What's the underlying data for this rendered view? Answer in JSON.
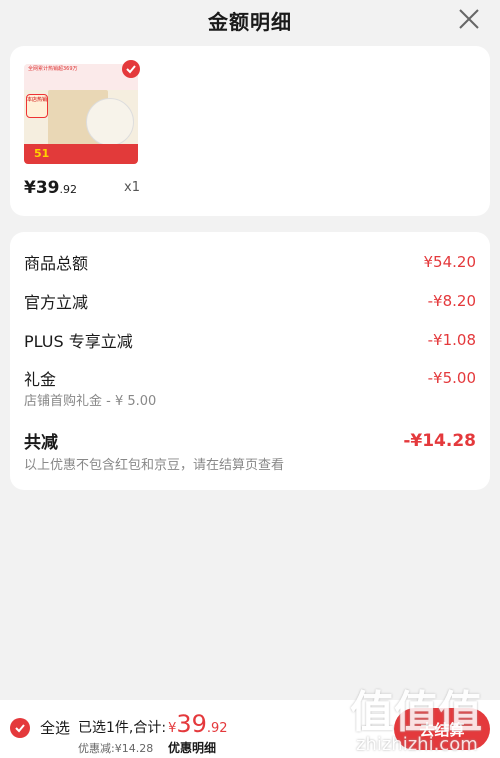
{
  "header": {
    "title": "金额明细"
  },
  "product": {
    "price_int": "¥39",
    "price_dec": ".92",
    "quantity": "x1",
    "thumb_banner": "全网累计热销超369万",
    "thumb_tag": "本店热销",
    "thumb_number": "51"
  },
  "details": {
    "rows": [
      {
        "label": "商品总额",
        "value": "¥54.20"
      },
      {
        "label": "官方立减",
        "value": "-¥8.20"
      },
      {
        "label": "PLUS 专享立减",
        "value": "-¥1.08"
      },
      {
        "label": "礼金",
        "value": "-¥5.00",
        "sub": "店铺首购礼金 - ¥ 5.00"
      }
    ],
    "total": {
      "label": "共减",
      "value": "-¥14.28",
      "note": "以上优惠不包含红包和京豆，请在结算页查看"
    }
  },
  "bottom": {
    "select_all": "全选",
    "selected_text": "已选1件,合计:",
    "currency": "¥",
    "total_int": "39",
    "total_dec": ".92",
    "discount": "优惠减:¥14.28",
    "detail_link": "优惠明细",
    "checkout": "去结算"
  },
  "watermark": {
    "big": "值值值",
    "small": "zhizhizhi.com"
  },
  "colors": {
    "accent": "#e4393c",
    "background": "#f2f2f2",
    "card": "#ffffff"
  }
}
